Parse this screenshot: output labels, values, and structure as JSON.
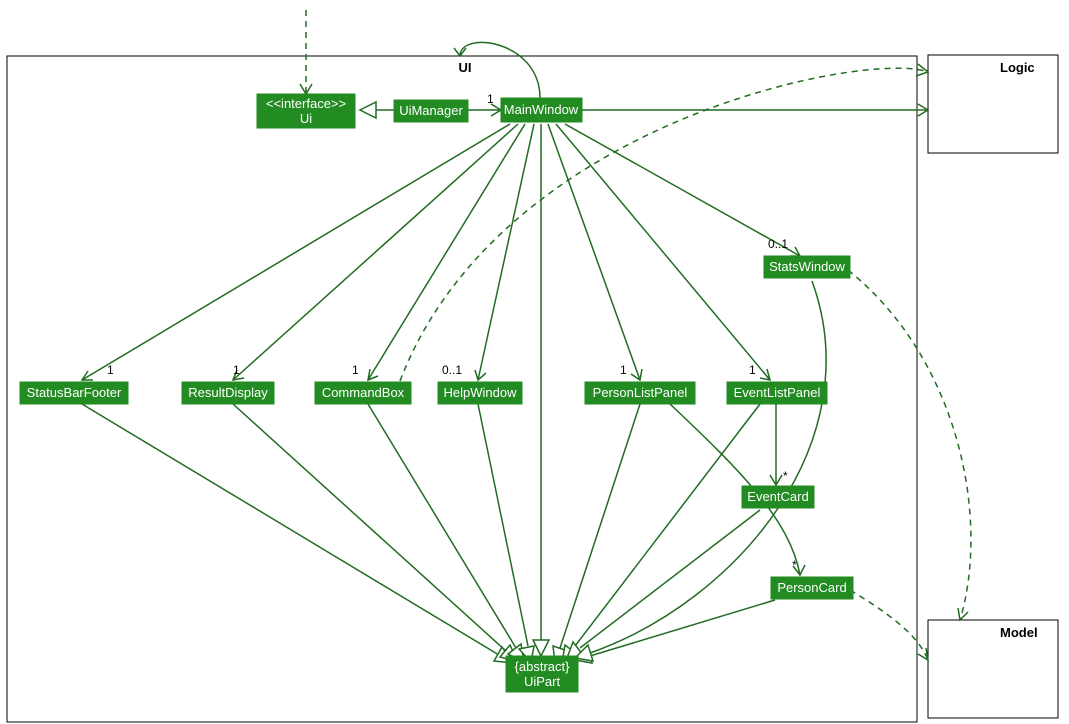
{
  "packages": {
    "ui": {
      "label": "UI"
    },
    "logic": {
      "label": "Logic"
    },
    "model": {
      "label": "Model"
    }
  },
  "classes": {
    "ui_iface": {
      "stereotype": "<<interface>>",
      "name": "Ui"
    },
    "uimanager": {
      "name": "UiManager"
    },
    "mainwindow": {
      "name": "MainWindow"
    },
    "statswindow": {
      "name": "StatsWindow"
    },
    "statusbarfooter": {
      "name": "StatusBarFooter"
    },
    "resultdisplay": {
      "name": "ResultDisplay"
    },
    "commandbox": {
      "name": "CommandBox"
    },
    "helpwindow": {
      "name": "HelpWindow"
    },
    "personlistpanel": {
      "name": "PersonListPanel"
    },
    "eventlistpanel": {
      "name": "EventListPanel"
    },
    "eventcard": {
      "name": "EventCard"
    },
    "personcard": {
      "name": "PersonCard"
    },
    "uipart": {
      "stereotype": "{abstract}",
      "name": "UiPart"
    }
  },
  "multiplicities": {
    "uimanager_mainwindow": "1",
    "mainwindow_statusbarfooter": "1",
    "mainwindow_resultdisplay": "1",
    "mainwindow_commandbox": "1",
    "mainwindow_helpwindow": "0..1",
    "mainwindow_personlistpanel": "1",
    "mainwindow_eventlistpanel": "1",
    "mainwindow_statswindow": "0..1",
    "eventlistpanel_eventcard": "*",
    "personlistpanel_personcard": "*"
  },
  "chart_data": {
    "type": "uml-class-diagram",
    "packages": [
      "UI",
      "Logic",
      "Model"
    ],
    "classes": [
      {
        "id": "Ui",
        "package": "UI",
        "stereotype": "interface"
      },
      {
        "id": "UiManager",
        "package": "UI"
      },
      {
        "id": "MainWindow",
        "package": "UI"
      },
      {
        "id": "StatsWindow",
        "package": "UI"
      },
      {
        "id": "StatusBarFooter",
        "package": "UI"
      },
      {
        "id": "ResultDisplay",
        "package": "UI"
      },
      {
        "id": "CommandBox",
        "package": "UI"
      },
      {
        "id": "HelpWindow",
        "package": "UI"
      },
      {
        "id": "PersonListPanel",
        "package": "UI"
      },
      {
        "id": "EventListPanel",
        "package": "UI"
      },
      {
        "id": "EventCard",
        "package": "UI"
      },
      {
        "id": "PersonCard",
        "package": "UI"
      },
      {
        "id": "UiPart",
        "package": "UI",
        "stereotype": "abstract"
      }
    ],
    "relations": [
      {
        "from": "(external)",
        "to": "Ui",
        "kind": "dependency"
      },
      {
        "from": "UiManager",
        "to": "Ui",
        "kind": "realization"
      },
      {
        "from": "UiManager",
        "to": "MainWindow",
        "kind": "association",
        "mult_to": "1"
      },
      {
        "from": "MainWindow",
        "to": "Logic",
        "kind": "association"
      },
      {
        "from": "MainWindow",
        "to": "StatusBarFooter",
        "kind": "association",
        "mult_to": "1"
      },
      {
        "from": "MainWindow",
        "to": "ResultDisplay",
        "kind": "association",
        "mult_to": "1"
      },
      {
        "from": "MainWindow",
        "to": "CommandBox",
        "kind": "association",
        "mult_to": "1"
      },
      {
        "from": "MainWindow",
        "to": "HelpWindow",
        "kind": "association",
        "mult_to": "0..1"
      },
      {
        "from": "MainWindow",
        "to": "PersonListPanel",
        "kind": "association",
        "mult_to": "1"
      },
      {
        "from": "MainWindow",
        "to": "EventListPanel",
        "kind": "association",
        "mult_to": "1"
      },
      {
        "from": "MainWindow",
        "to": "StatsWindow",
        "kind": "association",
        "mult_to": "0..1"
      },
      {
        "from": "MainWindow",
        "to": "UiPart",
        "kind": "generalization"
      },
      {
        "from": "EventListPanel",
        "to": "EventCard",
        "kind": "association",
        "mult_to": "*"
      },
      {
        "from": "PersonListPanel",
        "to": "PersonCard",
        "kind": "association",
        "mult_to": "*"
      },
      {
        "from": "StatusBarFooter",
        "to": "UiPart",
        "kind": "generalization"
      },
      {
        "from": "ResultDisplay",
        "to": "UiPart",
        "kind": "generalization"
      },
      {
        "from": "CommandBox",
        "to": "UiPart",
        "kind": "generalization"
      },
      {
        "from": "HelpWindow",
        "to": "UiPart",
        "kind": "generalization"
      },
      {
        "from": "PersonListPanel",
        "to": "UiPart",
        "kind": "generalization"
      },
      {
        "from": "EventListPanel",
        "to": "UiPart",
        "kind": "generalization"
      },
      {
        "from": "StatsWindow",
        "to": "UiPart",
        "kind": "generalization"
      },
      {
        "from": "EventCard",
        "to": "UiPart",
        "kind": "generalization"
      },
      {
        "from": "PersonCard",
        "to": "UiPart",
        "kind": "generalization"
      },
      {
        "from": "PersonCard",
        "to": "Model",
        "kind": "dependency"
      },
      {
        "from": "StatsWindow",
        "to": "Model",
        "kind": "dependency"
      },
      {
        "from": "CommandBox",
        "to": "Logic",
        "kind": "dependency"
      }
    ]
  }
}
